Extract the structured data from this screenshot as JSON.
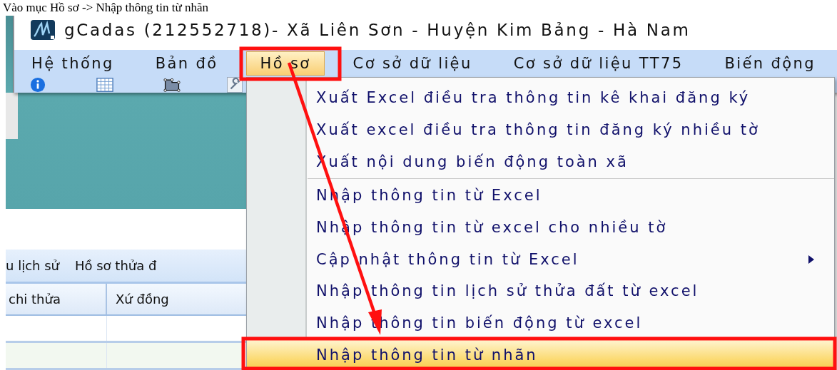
{
  "caption": "Vào mục Hồ sơ -> Nhập thông tin từ nhãn",
  "window": {
    "title": "gCadas (212552718)- Xã Liên Sơn - Huyện Kim Bảng - Hà Nam",
    "menu": [
      {
        "label": "Hệ thống",
        "selected": false
      },
      {
        "label": "Bản đồ",
        "selected": false
      },
      {
        "label": "Hồ sơ",
        "selected": true
      },
      {
        "label": "Cơ sở dữ liệu",
        "selected": false
      },
      {
        "label": "Cơ sở dữ liệu TT75",
        "selected": false
      },
      {
        "label": "Biến động",
        "selected": false
      }
    ]
  },
  "dropdown": {
    "items": [
      {
        "kind": "item",
        "label": "Xuất Excel điều tra thông tin kê khai đăng ký",
        "selected": false,
        "has_submenu": false
      },
      {
        "kind": "item",
        "label": "Xuất excel điều tra thông tin đăng ký nhiều tờ",
        "selected": false,
        "has_submenu": false
      },
      {
        "kind": "item",
        "label": "Xuất nội dung biến động toàn xã",
        "selected": false,
        "has_submenu": false
      },
      {
        "kind": "separator"
      },
      {
        "kind": "item",
        "label": "Nhập thông tin từ Excel",
        "selected": false,
        "has_submenu": false
      },
      {
        "kind": "item",
        "label": "Nhập thông tin từ excel cho nhiều tờ",
        "selected": false,
        "has_submenu": false
      },
      {
        "kind": "item",
        "label": "Cập nhật thông tin từ Excel",
        "selected": false,
        "has_submenu": true
      },
      {
        "kind": "item",
        "label": "Nhập thông tin lịch sử thửa đất từ excel",
        "selected": false,
        "has_submenu": false
      },
      {
        "kind": "item",
        "label": "Nhập thông tin biến động từ excel",
        "selected": false,
        "has_submenu": false
      },
      {
        "kind": "item",
        "label": "Nhập thông tin từ nhãn",
        "selected": true,
        "has_submenu": false
      }
    ]
  },
  "background": {
    "tabs": [
      {
        "label": "u lịch sử"
      },
      {
        "label": "Hồ sơ thửa đ"
      }
    ],
    "columns": [
      "chi thửa",
      "Xứ đồng"
    ]
  }
}
